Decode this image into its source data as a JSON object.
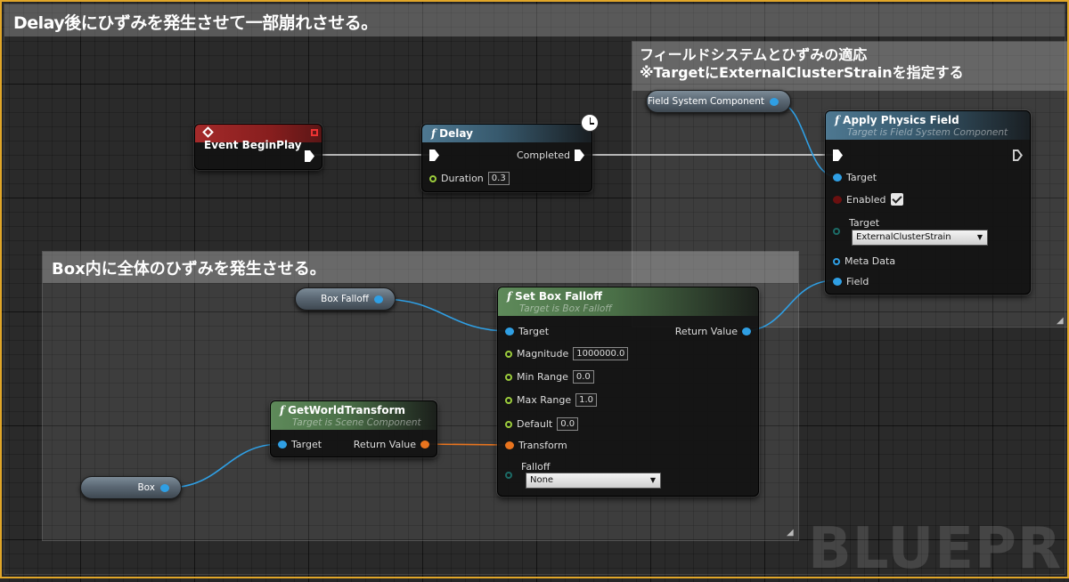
{
  "comments": {
    "main_title": "Delay後にひずみを発生させて一部崩れさせる。",
    "field_title_line1": "フィールドシステムとひずみの適応",
    "field_title_line2": "※TargetにExternalClusterStrainを指定する",
    "box_title": "Box内に全体のひずみを発生させる。"
  },
  "watermark": "BLUEPRINT",
  "nodes": {
    "event_begin_play": {
      "title": "Event BeginPlay"
    },
    "delay": {
      "title": "Delay",
      "completed_label": "Completed",
      "duration_label": "Duration",
      "duration_value": "0.3"
    },
    "field_system_component": {
      "label": "Field System Component"
    },
    "apply_physics_field": {
      "title": "Apply Physics Field",
      "subtitle": "Target is Field System Component",
      "target_label": "Target",
      "enabled_label": "Enabled",
      "target_type_label": "Target",
      "target_type_value": "ExternalClusterStrain",
      "meta_data_label": "Meta Data",
      "field_label": "Field"
    },
    "box_falloff": {
      "label": "Box Falloff"
    },
    "set_box_falloff": {
      "title": "Set Box Falloff",
      "subtitle": "Target is Box Falloff",
      "target_label": "Target",
      "return_label": "Return Value",
      "magnitude_label": "Magnitude",
      "magnitude_value": "1000000.0",
      "min_range_label": "Min Range",
      "min_range_value": "0.0",
      "max_range_label": "Max Range",
      "max_range_value": "1.0",
      "default_label": "Default",
      "default_value": "0.0",
      "transform_label": "Transform",
      "falloff_label": "Falloff",
      "falloff_value": "None"
    },
    "get_world_transform": {
      "title": "GetWorldTransform",
      "subtitle": "Target is Scene Component",
      "target_label": "Target",
      "return_label": "Return Value"
    },
    "box": {
      "label": "Box"
    }
  },
  "colors": {
    "object_pin": "#2f9fe4",
    "float_pin": "#9ccd3c",
    "transform_pin": "#e9741e",
    "exec_wire": "#e8e8e8",
    "frame_border": "#e1a628"
  }
}
